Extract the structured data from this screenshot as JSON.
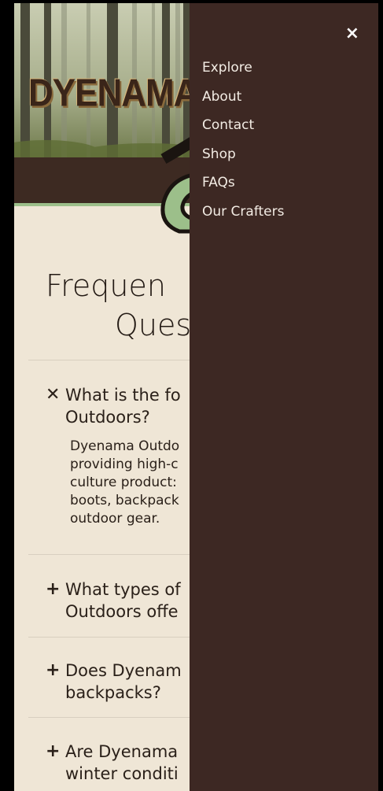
{
  "brand": {
    "logo_text": "DYENAMA"
  },
  "faq": {
    "title_line1": "Frequen",
    "title_line2": "Ques",
    "items": [
      {
        "icon": "close-icon",
        "mark": "✕",
        "question": "What is the fo\nOutdoors?",
        "expanded": true,
        "answer": "Dyenama Outdo\nproviding high-c\nculture product:\nboots, backpack\noutdoor gear."
      },
      {
        "icon": "plus-icon",
        "mark": "+",
        "question": "What types of\nOutdoors offe",
        "expanded": false
      },
      {
        "icon": "plus-icon",
        "mark": "+",
        "question": "Does Dyenam\nbackpacks?",
        "expanded": false
      },
      {
        "icon": "plus-icon",
        "mark": "+",
        "question": "Are Dyenama\nwinter conditi",
        "expanded": false
      }
    ]
  },
  "drawer": {
    "close_label": "×",
    "menu": [
      "Explore",
      "About",
      "Contact",
      "Shop",
      "FAQs",
      "Our Crafters"
    ]
  },
  "colors": {
    "page_bg": "#efe6d6",
    "drawer_bg": "#3d2823",
    "band_brown": "#3d2a22",
    "accent_green": "#9cbf8a",
    "text_dark": "#231a14"
  }
}
